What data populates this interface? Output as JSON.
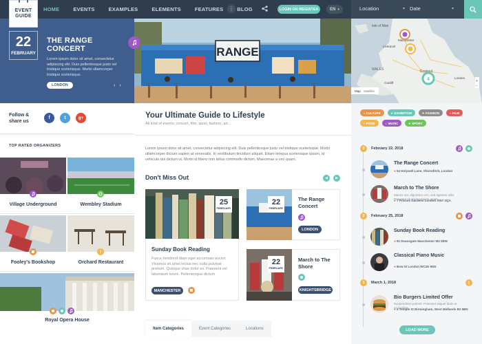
{
  "logo": {
    "line1": "EVENT",
    "line2": "GUIDE"
  },
  "nav": [
    "HOME",
    "EVENTS",
    "EXAMPLES",
    "ELEMENTS",
    "FEATURES",
    "BLOG"
  ],
  "header": {
    "login": "LOGIN OR REGISTER",
    "lang": "EN",
    "location": "Location",
    "date": "Date"
  },
  "hero": {
    "day": "22",
    "month": "FEBRUARY",
    "title": "THE RANGE CONCERT",
    "text": "Lorem ipsum dolor sit amet, consectetur adipiscing elit. Duis pellentesque justo vel tristique scelerisque. Morbi ullamcorper tristique scelerisque.",
    "button": "LONDON",
    "photo_sign": "RANGE"
  },
  "map": {
    "labels": [
      "Isle of Man",
      "Manchester",
      "Liverpool",
      "WALES",
      "England",
      "Cardiff",
      "London"
    ],
    "cluster": "4",
    "tab_map": "Map",
    "tab_sat": "Satellite"
  },
  "follow": {
    "label": "Follow & share us",
    "fb": "f",
    "tw": "t",
    "gp": "g+"
  },
  "guide": {
    "title": "Your Ultimate Guide to Lifestyle",
    "subtitle": "All kind of events: concert, film, sport, fashion, art.."
  },
  "lorem": "Lorem ipsum dolor sit amet, consectetur adipiscing elit. Duis pellentesque justo vel tristique scelerisque. Morbi ullamcorper dictum sapien at venenatis. In vestibulum tincidunt aliquet. Etiam tempus scelerisque ipsum, id vehicula dui dictum ut. Morbi id libero non tellus commodo dictum. Maecenas a orci quam.",
  "dont_miss": "Don't Miss Out",
  "featured": {
    "day": "25",
    "month": "FEBRUARY",
    "title": "Sunday Book Reading",
    "text": "Fusce hendrerit diam eget accumsan auctor. Vivamus sit amet lectus nec nulla pulvinar pretium. Quisque vitae dolor ex. Praesent vel bibendum lorem. Pellentesque dictum",
    "button": "MANCHESTER"
  },
  "small_cards": [
    {
      "day": "22",
      "month": "FEBRUARY",
      "title": "The Range Concert",
      "button": "LONDON"
    },
    {
      "day": "22",
      "month": "FEBRUARY",
      "title": "March to The Shore",
      "button": "KNIGHTSBRIDGE"
    }
  ],
  "tabs": [
    "Item Categories",
    "Event Categories",
    "Locations"
  ],
  "organizers": {
    "label": "TOP RATED ORGANIZERS",
    "items": [
      "Village Underground",
      "Wembley Stadium",
      "Fooley's Bookshop",
      "Orchard Restaurant",
      "Royal Opera House"
    ]
  },
  "categories": [
    {
      "label": "CULTURE",
      "color": "#e8944a"
    },
    {
      "label": "EXHIBITION",
      "color": "#69c6b8"
    },
    {
      "label": "FASHION",
      "color": "#8d8d8d"
    },
    {
      "label": "FILM",
      "color": "#e05b5b"
    },
    {
      "label": "FOOD",
      "color": "#f3b64c"
    },
    {
      "label": "MUSIC",
      "color": "#a058c9"
    },
    {
      "label": "SPORT",
      "color": "#6cc55a"
    }
  ],
  "timeline": [
    {
      "num": "2",
      "date": "February 22, 2018",
      "events": [
        {
          "title": "The Range Concert",
          "loc": "54 Holywell Lane, Shoreditch, London"
        },
        {
          "title": "March to The Shore",
          "desc": "Mauris nec dignissim orci, sed egestas odio. Praesent sit amet pretium quam.",
          "loc": "7 Princes Gardens London SW7 2QA"
        }
      ]
    },
    {
      "num": "2",
      "date": "February 25, 2018",
      "events": [
        {
          "title": "Sunday Book Reading",
          "loc": "91 Deansgate Manchester M3 2BW"
        },
        {
          "title": "Classical Piano Music",
          "loc": "Bow St London WC2E 9DD"
        }
      ]
    },
    {
      "num": "1",
      "date": "March 1, 2018",
      "events": [
        {
          "title": "Bio Burgers Limited Offer",
          "desc": "Suspendisse potenti. Praesent aliquet diam ut mi facilisis.",
          "loc": "4 Temple St Birmingham, West Midlands B2 5BN"
        }
      ]
    }
  ],
  "load_more": "LOAD MORE"
}
